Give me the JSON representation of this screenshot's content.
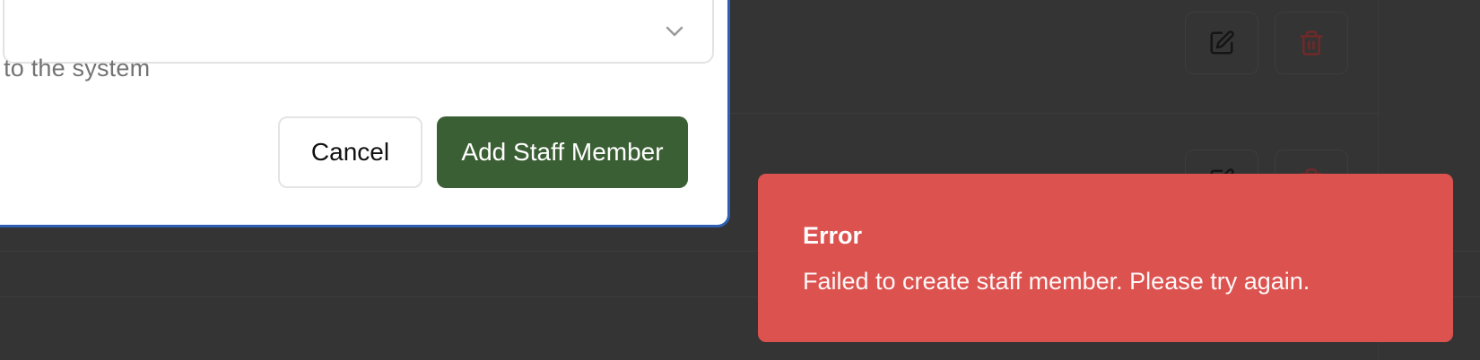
{
  "dialog": {
    "role_select": {
      "value": "",
      "icon": "chevron-down-icon"
    },
    "helper_text": "ss to the system",
    "cancel_label": "Cancel",
    "submit_label": "Add Staff Member"
  },
  "background_table": {
    "row_actions": [
      {
        "edit_icon": "edit-icon",
        "delete_icon": "trash-icon"
      },
      {
        "edit_icon": "edit-icon",
        "delete_icon": "trash-icon"
      }
    ]
  },
  "toast": {
    "title": "Error",
    "message": "Failed to create staff member. Please try again.",
    "color": "#dc524f"
  },
  "colors": {
    "primary": "#3b5f34",
    "dialog_border": "#2f5fb3",
    "overlay": "#343434",
    "danger_icon": "#6e2a28"
  }
}
